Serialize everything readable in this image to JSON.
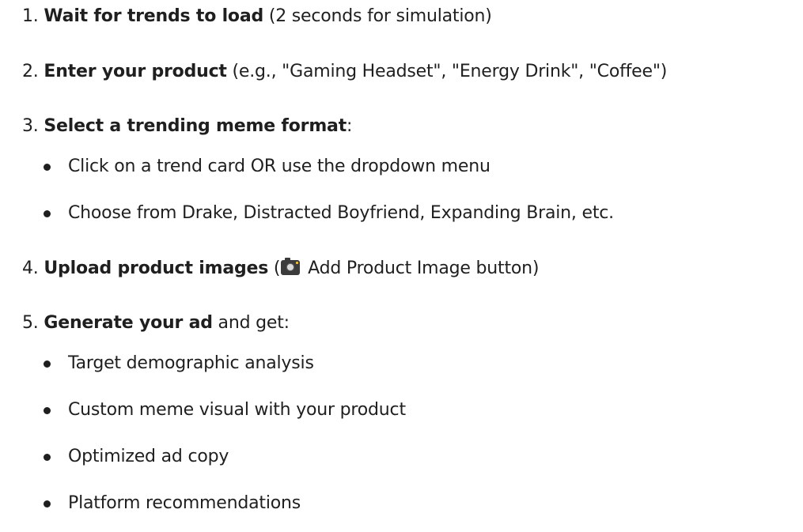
{
  "steps": [
    {
      "num": "1.",
      "bold": "Wait for trends to load",
      "rest": " (2 seconds for simulation)"
    },
    {
      "num": "2.",
      "bold": "Enter your product",
      "rest": " (e.g., \"Gaming Headset\", \"Energy Drink\", \"Coffee\")"
    },
    {
      "num": "3.",
      "bold": "Select a trending meme format",
      "rest": ":",
      "bullets": [
        "Click on a trend card OR use the dropdown menu",
        "Choose from Drake, Distracted Boyfriend, Expanding Brain, etc."
      ]
    },
    {
      "num": "4.",
      "bold": "Upload product images",
      "pre_icon": " (",
      "icon": "camera-icon",
      "post_icon": " Add Product Image button)"
    },
    {
      "num": "5.",
      "bold": "Generate your ad",
      "rest": " and get:",
      "bullets": [
        "Target demographic analysis",
        "Custom meme visual with your product",
        "Optimized ad copy",
        "Platform recommendations"
      ]
    }
  ]
}
